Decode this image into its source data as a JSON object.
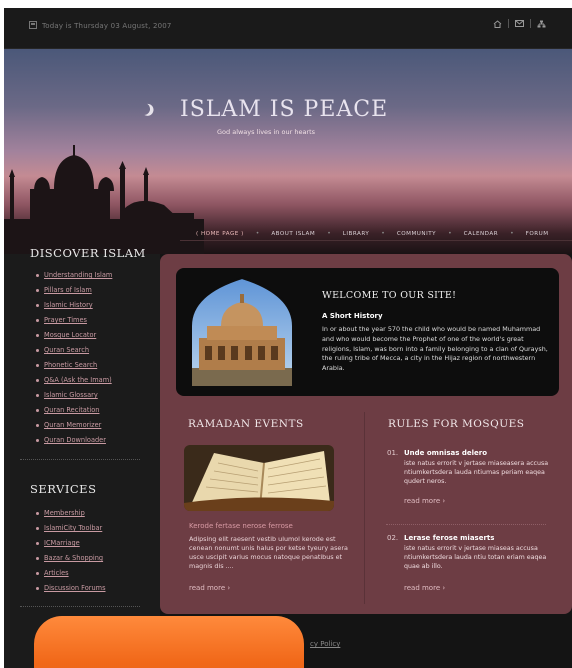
{
  "topbar": {
    "date": "Today is Thursday 03 August, 2007",
    "icons": [
      "home-icon",
      "mail-icon",
      "sitemap-icon"
    ]
  },
  "header": {
    "title": "ISLAM IS PEACE",
    "tagline": "God always lives in our hearts"
  },
  "nav": [
    {
      "label": "( HOME PAGE )",
      "active": true
    },
    {
      "label": "ABOUT ISLAM",
      "active": false
    },
    {
      "label": "LIBRARY",
      "active": false
    },
    {
      "label": "COMMUNITY",
      "active": false
    },
    {
      "label": "CALENDAR",
      "active": false
    },
    {
      "label": "FORUM",
      "active": false
    }
  ],
  "sidebar": {
    "discover_title": "DISCOVER ISLAM",
    "discover_items": [
      "Understanding Islam",
      "Pillars of Islam",
      "Islamic History",
      "Prayer Times",
      "Mosque Locator",
      "Quran Search",
      "Phonetic Search",
      "Q&A (Ask the Imam)",
      "Islamic Glossary",
      "Quran Recitation",
      "Quran Memorizer",
      "Quran Downloader"
    ],
    "services_title": "SERVICES",
    "services_items": [
      "Membership",
      "IslamiCity Toolbar",
      "ICMarriage",
      "Bazar & Shopping",
      "Articles",
      "Discussion Forums"
    ]
  },
  "welcome": {
    "title": "WELCOME TO OUR SITE!",
    "subtitle": "A Short History",
    "text": "In or about the year 570 the child who would be named Muhammad and who would become the Prophet of one of the world's great religions, Islam, was born into a family belonging to a clan of Quraysh, the ruling tribe of Mecca, a city in the Hijaz region of northwestern Arabia."
  },
  "ramadan": {
    "title": "RAMADAN EVENTS",
    "subtitle": "Kerode fertase nerose ferrose",
    "text": "Adipsing elit raesent vestib ulumol kerode est cenean nonumt unis halus por ketse tyeury asera usce uscipit varius mocus natoque penatibus et magnis dis ....",
    "read_more": "read more ›"
  },
  "rules": {
    "title": "RULES FOR MOSQUES",
    "items": [
      {
        "num": "01.",
        "head": "Unde omnisas delero",
        "text": "iste natus errorit v jertase miaseasera accusa ntiumkertsdera lauda ntiumas periam eaqea qudert neros.",
        "read_more": "read more ›"
      },
      {
        "num": "02.",
        "head": "Lerase ferose miaserts",
        "text": "iste natus errorit v jertase miaseas accusa ntiumkertsdera lauda ntiu totan eriam eaqea quae ab illo.",
        "read_more": "read more ›"
      }
    ]
  },
  "footer": {
    "link": "cy Policy"
  }
}
